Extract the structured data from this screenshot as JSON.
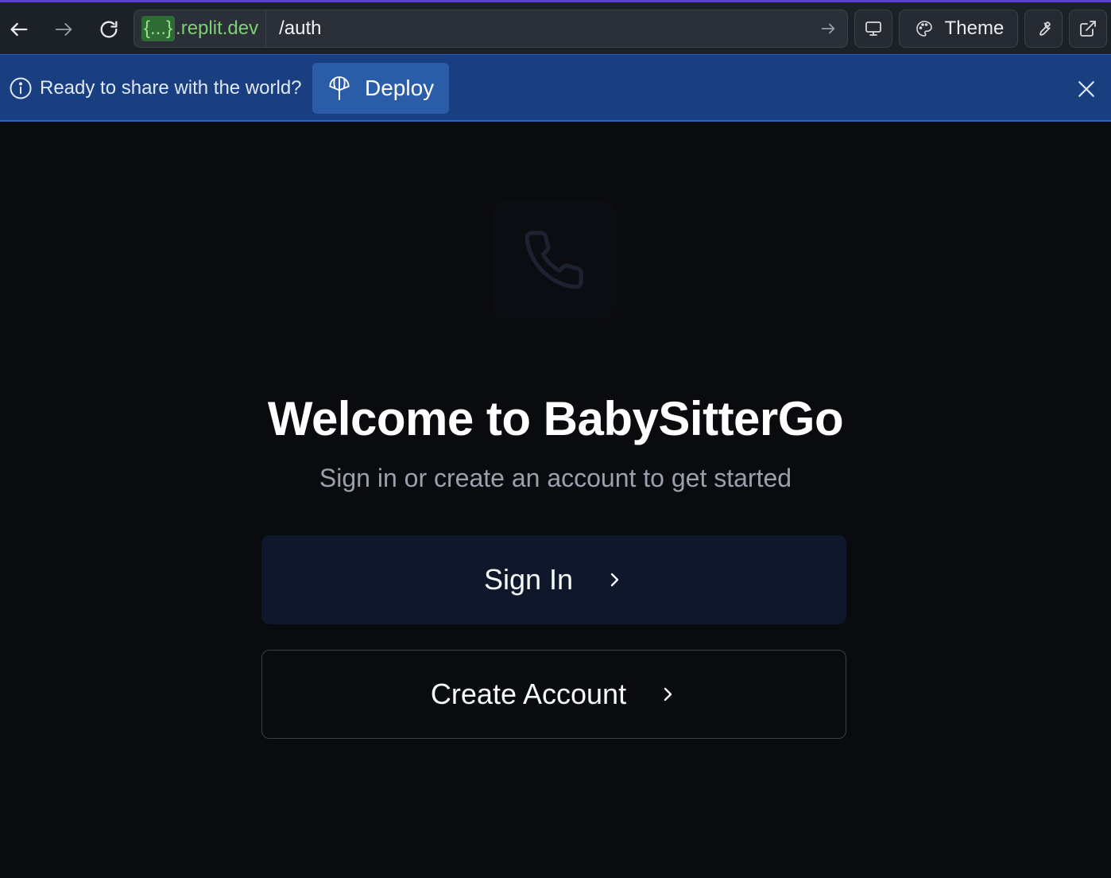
{
  "browser": {
    "url_domain_braces": "{...}",
    "url_domain_suffix": ".replit.dev",
    "url_path": "/auth",
    "theme_label": "Theme"
  },
  "banner": {
    "message": "Ready to share with the world?",
    "deploy_label": "Deploy"
  },
  "auth": {
    "title": "Welcome to BabySitterGo",
    "subtitle": "Sign in or create an account to get started",
    "sign_in_label": "Sign In",
    "create_account_label": "Create Account"
  },
  "colors": {
    "banner_bg": "#1a3f80",
    "deploy_btn": "#2b5ca8",
    "domain_green": "#7fcf75",
    "sign_in_bg": "#0f172a",
    "page_bg": "#0a0b0e"
  },
  "icons": [
    "back-icon",
    "forward-icon",
    "reload-icon",
    "arrow-right-icon",
    "monitor-icon",
    "palette-icon",
    "wrench-icon",
    "external-link-icon",
    "info-icon",
    "deploy-icon",
    "close-icon",
    "phone-icon",
    "chevron-right-icon"
  ]
}
